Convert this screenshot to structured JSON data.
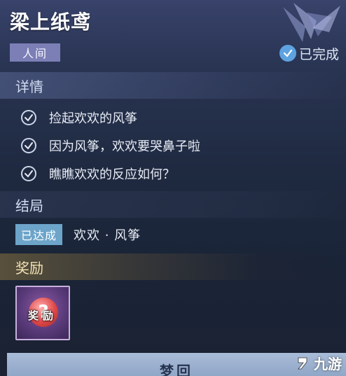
{
  "quest": {
    "title": "梁上纸鸢",
    "realm_tag": "人间",
    "status": "已完成"
  },
  "details": {
    "heading": "详情",
    "tasks": [
      "捡起欢欢的风筝",
      "因为风筝，欢欢要哭鼻子啦",
      "瞧瞧欢欢的反应如何？"
    ]
  },
  "ending": {
    "heading": "结局",
    "badge": "已达成",
    "text": "欢欢 · 风筝"
  },
  "reward": {
    "heading": "奖励",
    "item_label": "奖励",
    "item_glyph": "?"
  },
  "button": {
    "label": "梦回"
  },
  "watermark": {
    "text": "九游",
    "icon": "nine-game-logo-icon"
  },
  "colors": {
    "realm_tag": "#7c7fb6",
    "done_check": "#5ea3e0",
    "ending_badge": "#6da4c9",
    "reward_frame": "#5b3b7b"
  }
}
